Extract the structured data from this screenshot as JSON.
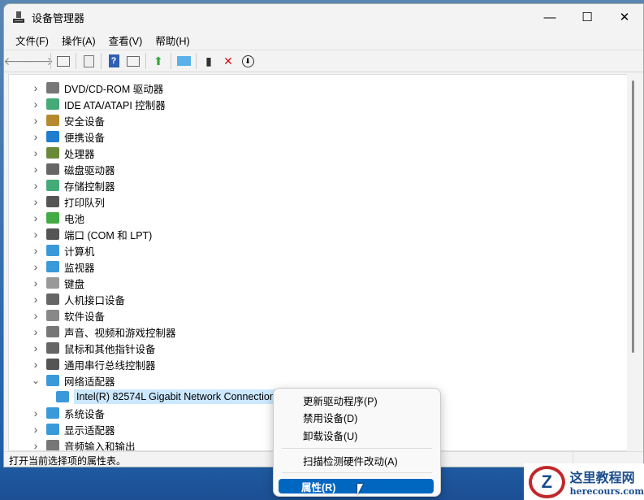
{
  "window": {
    "title": "设备管理器",
    "minimize": "—",
    "maximize": "☐",
    "close": "✕"
  },
  "menu": [
    "文件(F)",
    "操作(A)",
    "查看(V)",
    "帮助(H)"
  ],
  "toolbar": [
    "back-icon",
    "forward-icon",
    "show-hide-tree-icon",
    "properties-icon",
    "help-icon",
    "action-pane-icon",
    "update-driver-icon",
    "scan-hardware-icon",
    "enable-device-icon",
    "uninstall-icon",
    "disable-icon"
  ],
  "tree": [
    {
      "label": "DVD/CD-ROM 驱动器",
      "color": "#777"
    },
    {
      "label": "IDE ATA/ATAPI 控制器",
      "color": "#4a7"
    },
    {
      "label": "安全设备",
      "color": "#b58a2e"
    },
    {
      "label": "便携设备",
      "color": "#1f7ccf"
    },
    {
      "label": "处理器",
      "color": "#6a8a3a"
    },
    {
      "label": "磁盘驱动器",
      "color": "#666"
    },
    {
      "label": "存储控制器",
      "color": "#4a7"
    },
    {
      "label": "打印队列",
      "color": "#555"
    },
    {
      "label": "电池",
      "color": "#4a4"
    },
    {
      "label": "端口 (COM 和 LPT)",
      "color": "#555"
    },
    {
      "label": "计算机",
      "color": "#3a9ad9"
    },
    {
      "label": "监视器",
      "color": "#3a9ad9"
    },
    {
      "label": "键盘",
      "color": "#999"
    },
    {
      "label": "人机接口设备",
      "color": "#666"
    },
    {
      "label": "软件设备",
      "color": "#888"
    },
    {
      "label": "声音、视频和游戏控制器",
      "color": "#777"
    },
    {
      "label": "鼠标和其他指针设备",
      "color": "#666"
    },
    {
      "label": "通用串行总线控制器",
      "color": "#555"
    },
    {
      "label": "网络适配器",
      "color": "#3a9ad9",
      "expanded": true
    },
    {
      "label": "Intel(R) 82574L Gigabit Network Connection",
      "color": "#3a9ad9",
      "child": true,
      "selected": true
    },
    {
      "label": "系统设备",
      "color": "#3a9ad9"
    },
    {
      "label": "显示适配器",
      "color": "#3a9ad9"
    },
    {
      "label": "音频输入和输出",
      "color": "#777"
    }
  ],
  "status": "打开当前选择项的属性表。",
  "context_menu": {
    "items": [
      "更新驱动程序(P)",
      "禁用设备(D)",
      "卸载设备(U)",
      "扫描检测硬件改动(A)",
      "属性(R)"
    ]
  },
  "watermark": {
    "title": "这里教程网",
    "url": "herecours.com"
  }
}
